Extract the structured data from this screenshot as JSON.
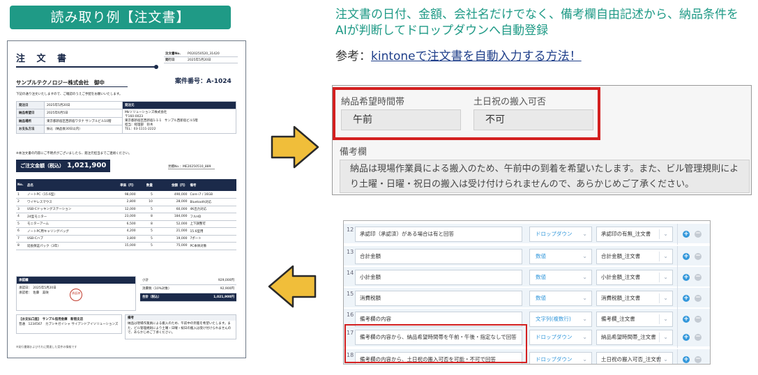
{
  "badge": "読み取り例【注文書】",
  "document": {
    "title": "注 文 書",
    "meta": [
      {
        "label": "注文書No.",
        "value": "PO20250520_31420"
      },
      {
        "label": "発行日",
        "value": "2025年5月20日"
      }
    ],
    "to": "サンプルテクノロジー株式会社　御中",
    "case_no": "案件番号：A-1024",
    "greeting": "下記の通り注文いたしますので、ご確認のうえご手配をお願いいたします。",
    "info": {
      "order_date_label": "発注日",
      "order_date": "2025年5月20日",
      "delivery_label": "納品希望日",
      "delivery": "2025年6月5日",
      "place_label": "納品場所",
      "place": "東京都新宿区西新宿ワタナ サンプルビル10階",
      "payment_label": "お支払方法",
      "payment": "振込（納品後30日以内）",
      "ship_head": "発注元",
      "ship_lines": [
        "Mkソリューションズ株式会社",
        "〒160-0023",
        "東京都新宿区西新宿1-1-1　サンプル西新宿ビル5階",
        "担当：経理部　鈴木",
        "TEL：03-1111-2222"
      ]
    },
    "note": "※本注文書の内容にご不明点がございましたら、発注元担当までご連絡ください。",
    "total_label": "ご注文金額（税込）",
    "total_amount": "1,021,900円",
    "estimate": "見積No.：ME20250510_889",
    "item_headers": [
      "No.",
      "品名",
      "単価（円）",
      "数量",
      "金額（円）",
      "備考"
    ],
    "items": [
      [
        "1",
        "ノートPC（15.6型）",
        "98,000",
        "5",
        "490,000",
        "Core i7 / 16GB"
      ],
      [
        "2",
        "ワイヤレスマウス",
        "2,800",
        "10",
        "28,000",
        "Bluetooth対応"
      ],
      [
        "3",
        "USB-Cドッキングステーション",
        "12,000",
        "5",
        "60,000",
        "4K出力対応"
      ],
      [
        "4",
        "24型モニター",
        "23,000",
        "8",
        "184,000",
        "フルHD"
      ],
      [
        "5",
        "モニターアーム",
        "6,500",
        "8",
        "52,000",
        "上下調整可"
      ],
      [
        "6",
        "ノートPC用キャリングバッグ",
        "4,200",
        "5",
        "21,000",
        "15.6型用"
      ],
      [
        "7",
        "USB-Cハブ",
        "3,800",
        "5",
        "19,000",
        "7ポート"
      ],
      [
        "8",
        "延長保証パック（3年）",
        "15,000",
        "5",
        "75,000",
        "PC本体対象"
      ]
    ],
    "approval": {
      "head": "承認欄",
      "approved": "承認日：　2025年5月20日",
      "approver": "承認者：　佐藤　美咲",
      "stamp": "承認済"
    },
    "summary": [
      {
        "label": "小計",
        "value": "929,000円"
      },
      {
        "label": "消費税（10%対象）",
        "value": "92,900円"
      },
      {
        "label": "合計（税込）",
        "value": "1,021,900円"
      }
    ],
    "bank": {
      "head": "【お支払口座】　サンプル信用金庫　新宿支店",
      "line": "普通　1234567　カブシキガイシャ サイアンドアイソリューションズ"
    },
    "remark_head": "備考",
    "remark": "納品は現場作業員による搬入のため、午前中の到着を希望いたします。また、ビル管理規則により土曜・日曜・祝日の搬入は受け付けられませんので、あらかじめご了承ください。",
    "footer": "※発行書類およびそれに関連した案件の情報です"
  },
  "headline": "注文書の日付、金額、会社名だけでなく、備考欄自由記述から、納品条件をAIが判断してドロップダウンへ自動登録",
  "ref": {
    "prefix": "参考：",
    "link": "kintoneで注文書を自動入力する方法！"
  },
  "form": {
    "delivery_time_label": "納品希望時間帯",
    "delivery_time_value": "午前",
    "holiday_label": "土日祝の搬入可否",
    "holiday_value": "不可",
    "remark_label": "備考欄",
    "remark_value": "納品は現場作業員による搬入のため、午前中の到着を希望いたします。また、ビル管理規則により土曜・日曜・祝日の搬入は受け付けられませんので、あらかじめご了承ください。"
  },
  "settings_rows": [
    {
      "no": "12",
      "text": "承認印（承認済）がある場合は有と回答",
      "type": "ドロップダウン",
      "field": "承認印の有無_注文書"
    },
    {
      "no": "13",
      "text": "合計金額",
      "type": "数値",
      "field": "合計金額_注文書"
    },
    {
      "no": "14",
      "text": "小計金額",
      "type": "数値",
      "field": "小計金額_注文書"
    },
    {
      "no": "15",
      "text": "消費税額",
      "type": "数値",
      "field": "消費税額_注文書"
    },
    {
      "no": "16",
      "text": "備考欄の内容",
      "type": "文字列(複数行)",
      "field": "備考欄_注文書"
    },
    {
      "no": "17",
      "text": "備考欄の内容から、納品希望時間帯を午前・午後・指定なしで回答",
      "type": "ドロップダウン",
      "field": "納品希望時間帯_注文書"
    },
    {
      "no": "18",
      "text": "備考欄の内容から、土日祝の搬入可否を可能・不可で回答",
      "type": "ドロップダウン",
      "field": "土日祝の搬入可否_注文書"
    }
  ],
  "colors": {
    "accent": "#1f9a86",
    "highlight": "#d32020",
    "navy": "#1b2a4a",
    "arrow": "#f0be3a"
  }
}
